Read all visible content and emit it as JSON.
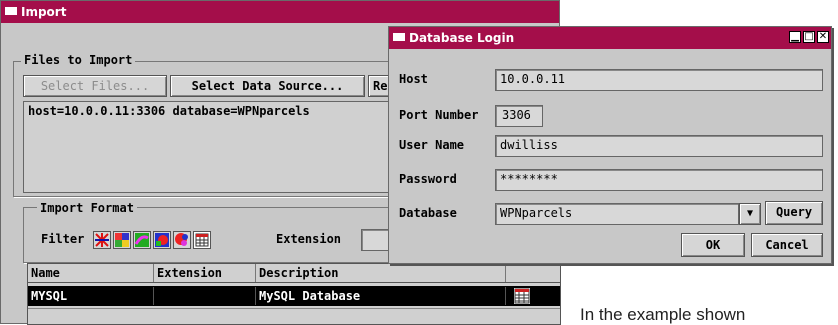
{
  "import_window": {
    "title": "Import",
    "files_group": {
      "label": "Files to Import",
      "select_files": "Select Files...",
      "select_data_source": "Select Data Source...",
      "third_button": "Re",
      "source_text": "host=10.0.0.11:3306  database=WPNparcels"
    },
    "format_group": {
      "label": "Import Format",
      "filter_label": "Filter",
      "extension_label": "Extension"
    },
    "table": {
      "columns": [
        "Name",
        "Extension",
        "Description"
      ],
      "rows": [
        {
          "name": "MYSQL",
          "extension": "",
          "description": "MySQL Database",
          "selected": true
        }
      ]
    }
  },
  "db_login": {
    "title": "Database Login",
    "fields": {
      "host_label": "Host",
      "host_value": "10.0.0.11",
      "port_label": "Port Number",
      "port_value": "3306",
      "user_label": "User Name",
      "user_value": "dwilliss",
      "password_label": "Password",
      "password_value": "********",
      "database_label": "Database",
      "database_value": "WPNparcels"
    },
    "query_button": "Query",
    "ok_button": "OK",
    "cancel_button": "Cancel"
  },
  "caption": "In the example shown",
  "colors": {
    "titlebar": "#a40e4a",
    "panel": "#c8c8c8"
  }
}
